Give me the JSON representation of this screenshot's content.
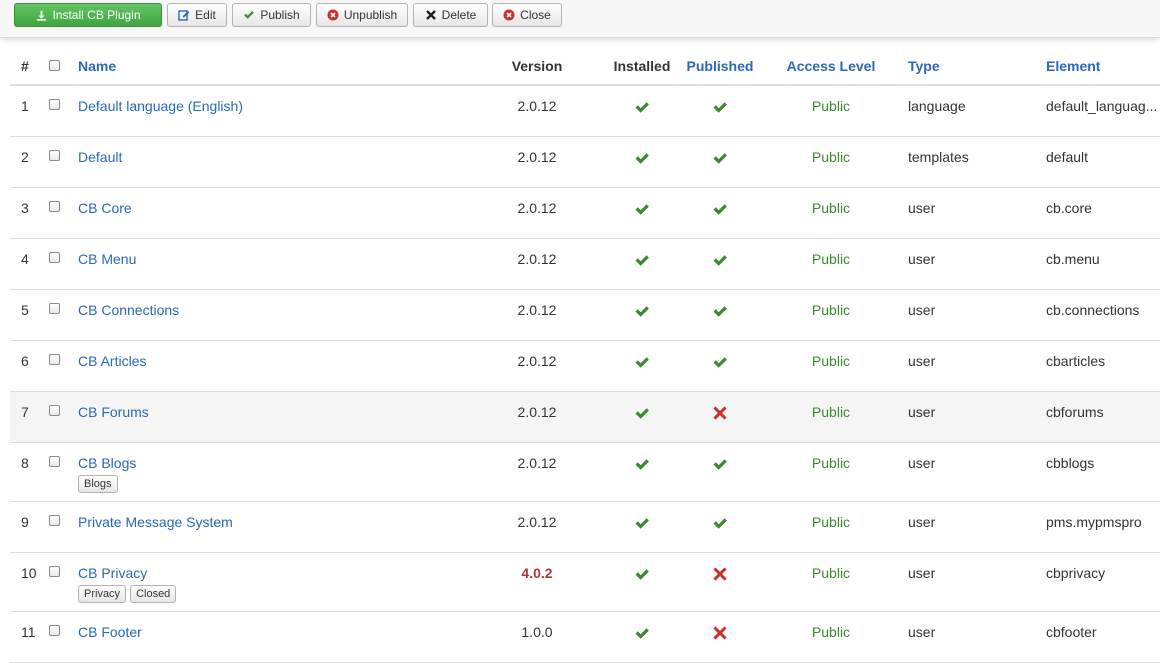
{
  "toolbar": {
    "install_label": "Install CB Plugin",
    "edit_label": "Edit",
    "publish_label": "Publish",
    "unpublish_label": "Unpublish",
    "delete_label": "Delete",
    "close_label": "Close"
  },
  "table": {
    "headers": {
      "num": "#",
      "name": "Name",
      "version": "Version",
      "installed": "Installed",
      "published": "Published",
      "access": "Access Level",
      "type": "Type",
      "element": "Element"
    },
    "rows": [
      {
        "num": "1",
        "name": "Default language (English)",
        "version": "2.0.12",
        "installed": true,
        "published": true,
        "access": "Public",
        "type": "language",
        "element": "default_languag..."
      },
      {
        "num": "2",
        "name": "Default",
        "version": "2.0.12",
        "installed": true,
        "published": true,
        "access": "Public",
        "type": "templates",
        "element": "default"
      },
      {
        "num": "3",
        "name": "CB Core",
        "version": "2.0.12",
        "installed": true,
        "published": true,
        "access": "Public",
        "type": "user",
        "element": "cb.core"
      },
      {
        "num": "4",
        "name": "CB Menu",
        "version": "2.0.12",
        "installed": true,
        "published": true,
        "access": "Public",
        "type": "user",
        "element": "cb.menu"
      },
      {
        "num": "5",
        "name": "CB Connections",
        "version": "2.0.12",
        "installed": true,
        "published": true,
        "access": "Public",
        "type": "user",
        "element": "cb.connections"
      },
      {
        "num": "6",
        "name": "CB Articles",
        "version": "2.0.12",
        "installed": true,
        "published": true,
        "access": "Public",
        "type": "user",
        "element": "cbarticles"
      },
      {
        "num": "7",
        "name": "CB Forums",
        "version": "2.0.12",
        "installed": true,
        "published": false,
        "access": "Public",
        "type": "user",
        "element": "cbforums"
      },
      {
        "num": "8",
        "name": "CB Blogs",
        "tags": [
          "Blogs"
        ],
        "version": "2.0.12",
        "installed": true,
        "published": true,
        "access": "Public",
        "type": "user",
        "element": "cbblogs"
      },
      {
        "num": "9",
        "name": "Private Message System",
        "version": "2.0.12",
        "installed": true,
        "published": true,
        "access": "Public",
        "type": "user",
        "element": "pms.mypmspro"
      },
      {
        "num": "10",
        "name": "CB Privacy",
        "tags": [
          "Privacy",
          "Closed"
        ],
        "version": "4.0.2",
        "version_outdated": true,
        "installed": true,
        "published": false,
        "access": "Public",
        "type": "user",
        "element": "cbprivacy"
      },
      {
        "num": "11",
        "name": "CB Footer",
        "version": "1.0.0",
        "installed": true,
        "published": false,
        "access": "Public",
        "type": "user",
        "element": "cbfooter"
      }
    ]
  },
  "colors": {
    "link": "#2a69b8",
    "access": "#3c8a2e",
    "check": "#3c8a2e",
    "cross": "#c9302c",
    "outdated_version": "#a83a3a",
    "install_button": "#51b451"
  },
  "icons": {
    "install": "download-icon",
    "edit": "edit-icon",
    "publish": "check-icon",
    "unpublish": "circle-x-icon",
    "delete": "x-icon",
    "close": "circle-x-icon",
    "installed": "check-icon",
    "published_yes": "check-icon",
    "published_no": "x-icon"
  }
}
